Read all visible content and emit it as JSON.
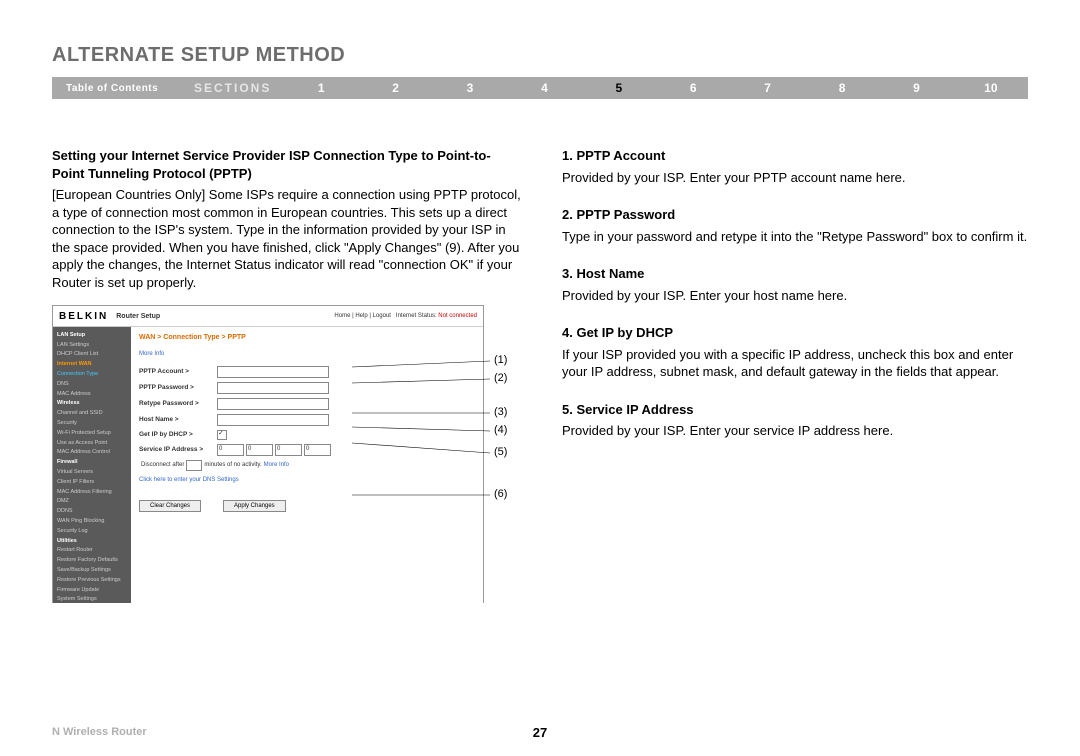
{
  "title": "ALTERNATE SETUP METHOD",
  "nav": {
    "toc": "Table of Contents",
    "sections_label": "SECTIONS",
    "items": [
      "1",
      "2",
      "3",
      "4",
      "5",
      "6",
      "7",
      "8",
      "9",
      "10"
    ],
    "active": "5"
  },
  "left": {
    "heading": "Setting your Internet Service Provider ISP Connection Type to Point-to-Point Tunneling Protocol (PPTP)",
    "para": "[European Countries Only] Some ISPs require a connection using PPTP protocol, a type of connection most common in European countries. This sets up a direct connection to the ISP's system. Type in the information provided by your ISP in the space provided. When you have finished, click \"Apply Changes\" (9). After you apply the changes, the Internet Status indicator will read \"connection OK\" if your Router is set up properly."
  },
  "right_items": [
    {
      "h": "1.   PPTP Account",
      "p": "Provided by your ISP. Enter your PPTP account name here."
    },
    {
      "h": "2.   PPTP Password",
      "p": "Type in your password and retype it into the \"Retype Password\" box to confirm it."
    },
    {
      "h": "3.   Host Name",
      "p": "Provided by your ISP. Enter your host name here."
    },
    {
      "h": "4.   Get IP by DHCP",
      "p": "If your ISP provided you with a specific IP address, uncheck this box and enter your IP address, subnet mask, and default gateway in the fields that appear."
    },
    {
      "h": "5.   Service IP Address",
      "p": "Provided by your ISP. Enter your service IP address here."
    }
  ],
  "router": {
    "logo": "BELKIN",
    "subtitle": "Router Setup",
    "topright_links": "Home | Help | Logout",
    "topright_status_label": "Internet Status:",
    "topright_status_value": "Not connected",
    "breadcrumb": "WAN > Connection Type > PPTP",
    "moreinfo": "More Info",
    "sidebar": [
      {
        "t": "LAN Setup",
        "c": "cat"
      },
      {
        "t": "LAN Settings"
      },
      {
        "t": "DHCP Client List"
      },
      {
        "t": "Internet WAN",
        "c": "cat hl-orange"
      },
      {
        "t": "Connection Type",
        "c": "hl-cyan"
      },
      {
        "t": "DNS"
      },
      {
        "t": "MAC Address"
      },
      {
        "t": "Wireless",
        "c": "cat"
      },
      {
        "t": "Channel and SSID"
      },
      {
        "t": "Security"
      },
      {
        "t": "Wi-Fi Protected Setup"
      },
      {
        "t": "Use as Access Point"
      },
      {
        "t": "MAC Address Control"
      },
      {
        "t": "Firewall",
        "c": "cat"
      },
      {
        "t": "Virtual Servers"
      },
      {
        "t": "Client IP Filters"
      },
      {
        "t": "MAC Address Filtering"
      },
      {
        "t": "DMZ"
      },
      {
        "t": "DDNS"
      },
      {
        "t": "WAN Ping Blocking"
      },
      {
        "t": "Security Log"
      },
      {
        "t": "Utilities",
        "c": "cat"
      },
      {
        "t": "Restart Router"
      },
      {
        "t": "Restore Factory Defaults"
      },
      {
        "t": "Save/Backup Settings"
      },
      {
        "t": "Restore Previous Settings"
      },
      {
        "t": "Firmware Update"
      },
      {
        "t": "System Settings"
      }
    ],
    "form": {
      "rows": [
        {
          "label": "PPTP Account >",
          "type": "text"
        },
        {
          "label": "PPTP Password >",
          "type": "text"
        },
        {
          "label": "Retype Password >",
          "type": "text"
        },
        {
          "label": "Host Name >",
          "type": "text"
        },
        {
          "label": "Get IP by DHCP >",
          "type": "checkbox",
          "checked": true
        },
        {
          "label": "Service IP Address >",
          "type": "ip",
          "octets": [
            "0",
            "0",
            "0",
            "0"
          ]
        }
      ],
      "disconnect_prefix": "Disconnect after",
      "disconnect_suffix": "minutes of no activity.",
      "disconnect_more": "More Info",
      "dns_link": "Click here to enter your DNS Settings",
      "btn_clear": "Clear Changes",
      "btn_apply": "Apply Changes"
    }
  },
  "callouts": [
    "(1)",
    "(2)",
    "(3)",
    "(4)",
    "(5)",
    "(6)"
  ],
  "footer": {
    "product": "N Wireless Router",
    "page": "27"
  }
}
